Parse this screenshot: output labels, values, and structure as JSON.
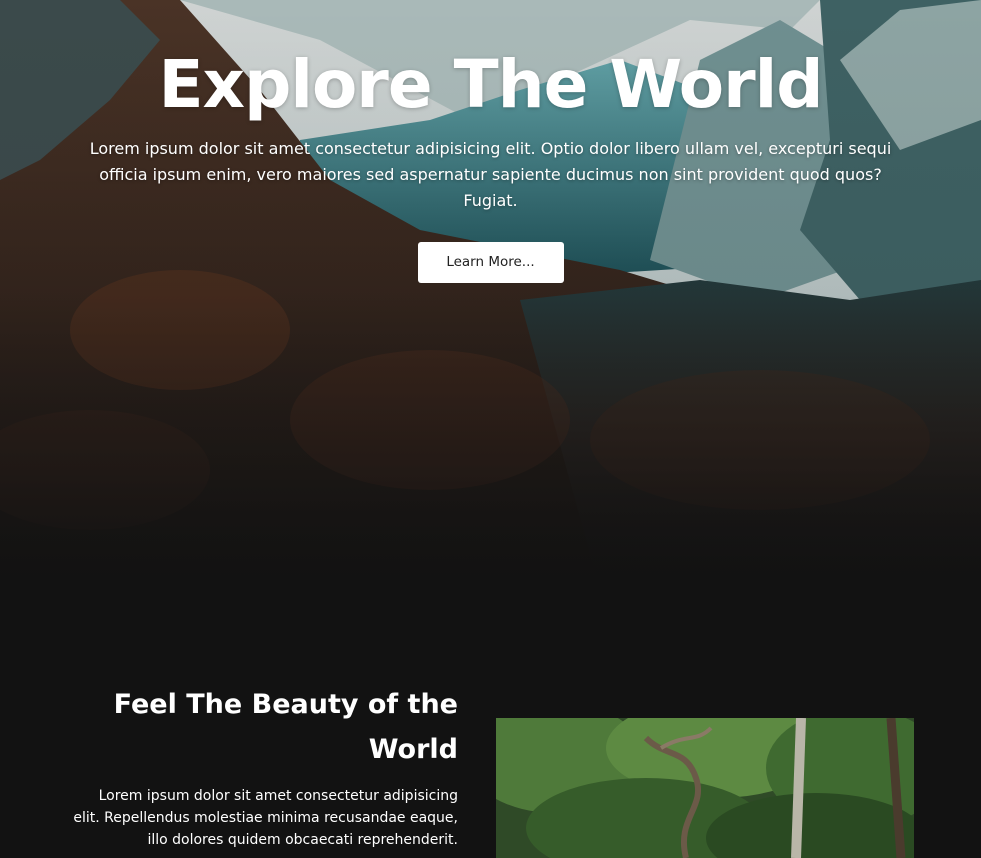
{
  "hero": {
    "title": "Explore The World",
    "text": "Lorem ipsum dolor sit amet consectetur adipisicing elit. Optio dolor libero ullam vel, excepturi sequi officia ipsum enim, vero maiores sed aspernatur sapiente ducimus non sint provident quod quos? Fugiat.",
    "button_label": "Learn More...",
    "background": "mountain-valley-forest-photo"
  },
  "feature": {
    "title": "Feel The Beauty of the World",
    "text": "Lorem ipsum dolor sit amet consectetur adipisicing elit. Repellendus molestiae minima recusandae eaque, illo dolores quidem obcaecati reprehenderit.",
    "image": "forest-trees-photo"
  },
  "colors": {
    "page_background": "#121212",
    "text": "#ffffff",
    "button_background": "#ffffff",
    "button_text": "#222222"
  }
}
